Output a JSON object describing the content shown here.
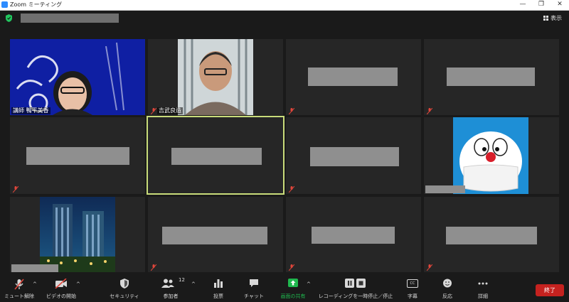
{
  "window": {
    "title": "Zoom ミーティング",
    "controls": {
      "minimize": "—",
      "restore": "❐",
      "close": "✕"
    }
  },
  "header": {
    "view_label": "表示"
  },
  "participants": [
    {
      "name": "講師 鴨平美香",
      "video": true
    },
    {
      "name": "吉武良造",
      "video": true,
      "muted": true
    },
    {
      "video": false,
      "muted": true
    },
    {
      "video": false,
      "muted": true
    },
    {
      "video": false,
      "muted": true
    },
    {
      "video": false,
      "active_speaker": true
    },
    {
      "video": false,
      "muted": true
    },
    {
      "video": false,
      "avatar_image": true
    },
    {
      "video": false,
      "photo": true
    },
    {
      "video": false,
      "muted": true
    },
    {
      "video": false,
      "muted": true
    },
    {
      "video": false,
      "muted": true
    }
  ],
  "toolbar": {
    "mute": "ミュート解除",
    "video": "ビデオの開始",
    "security": "セキュリティ",
    "participants": "参加者",
    "participants_count": "12",
    "polls": "投票",
    "chat": "チャット",
    "share": "画面の共有",
    "recording": "レコーディングを一時停止／停止",
    "captions": "字幕",
    "captions_icon": "CC",
    "reactions": "反応",
    "more": "詳細",
    "end": "終了"
  },
  "colors": {
    "background": "#1a1a1a",
    "tile": "#262626",
    "active_speaker_border": "#c9dc7a",
    "share_green": "#1fb84e",
    "end_red": "#c5221f",
    "mute_red": "#e0463b"
  }
}
